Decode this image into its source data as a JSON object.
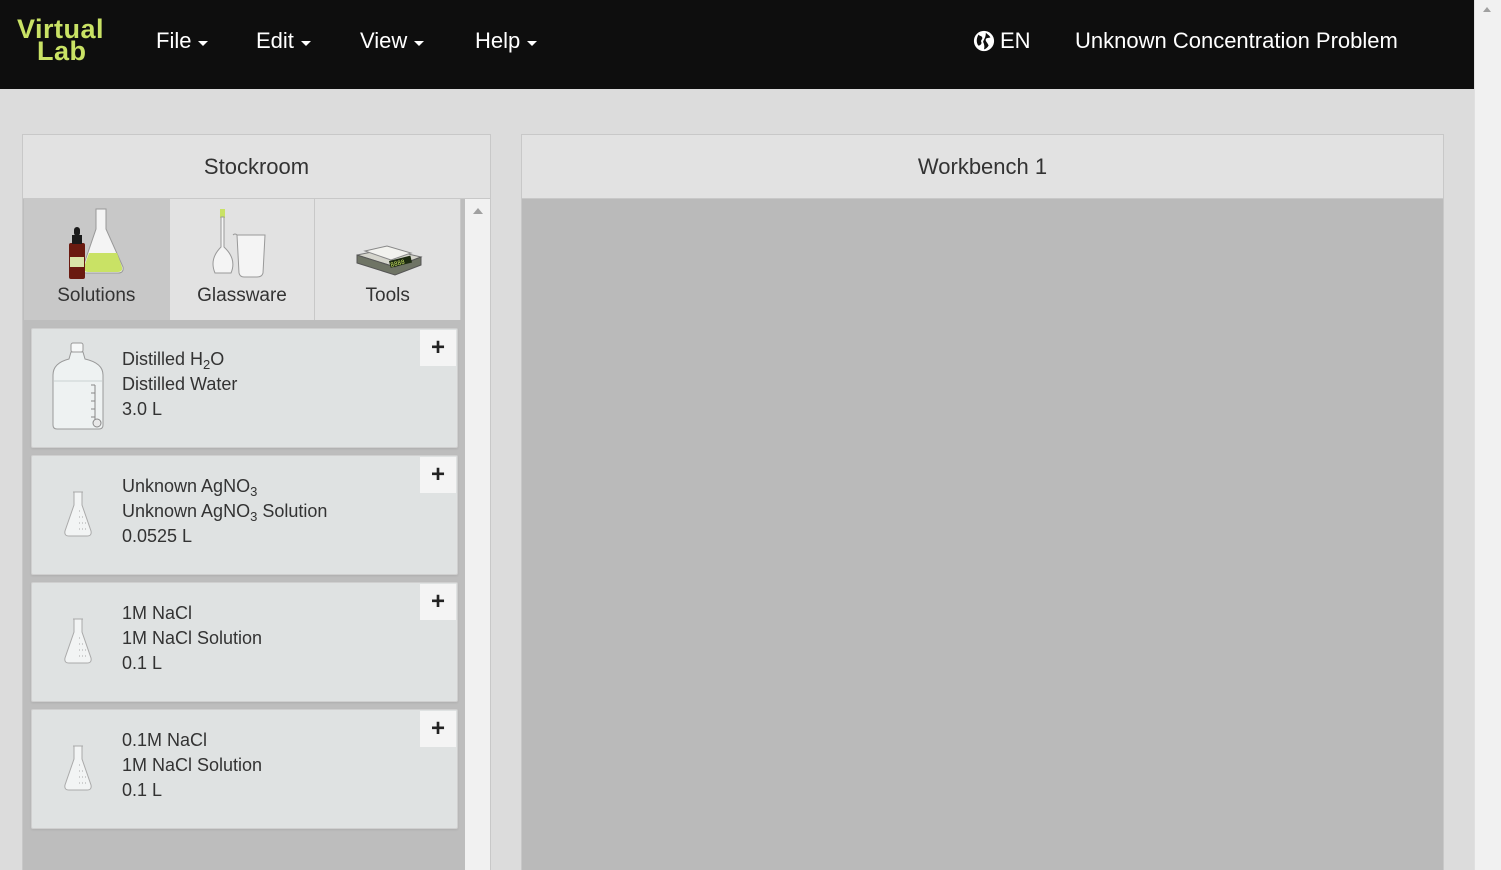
{
  "nav": {
    "logo_line1": "Virtual",
    "logo_line2": "Lab",
    "menu": [
      {
        "label": "File"
      },
      {
        "label": "Edit"
      },
      {
        "label": "View"
      },
      {
        "label": "Help"
      }
    ],
    "language": "EN",
    "problem_title": "Unknown Concentration Problem"
  },
  "stockroom": {
    "title": "Stockroom",
    "tabs": [
      {
        "label": "Solutions",
        "active": true
      },
      {
        "label": "Glassware",
        "active": false
      },
      {
        "label": "Tools",
        "active": false
      }
    ],
    "items": [
      {
        "name": "Distilled H₂O",
        "description": "Distilled Water",
        "volume": "3.0 L",
        "icon": "water-jug-icon"
      },
      {
        "name": "Unknown AgNO₃",
        "description": "Unknown AgNO₃ Solution",
        "volume": "0.0525 L",
        "icon": "flask-icon"
      },
      {
        "name": "1M NaCl",
        "description": "1M NaCl Solution",
        "volume": "0.1 L",
        "icon": "flask-icon"
      },
      {
        "name": "0.1M NaCl",
        "description": "1M NaCl Solution",
        "volume": "0.1 L",
        "icon": "flask-icon"
      }
    ],
    "add_label": "+"
  },
  "workbench": {
    "title": "Workbench 1"
  },
  "colors": {
    "navbar": "#0e0e0e",
    "logo": "#c9e265",
    "page_bg": "#dcdcdc",
    "workbench_bg": "#bababa"
  }
}
